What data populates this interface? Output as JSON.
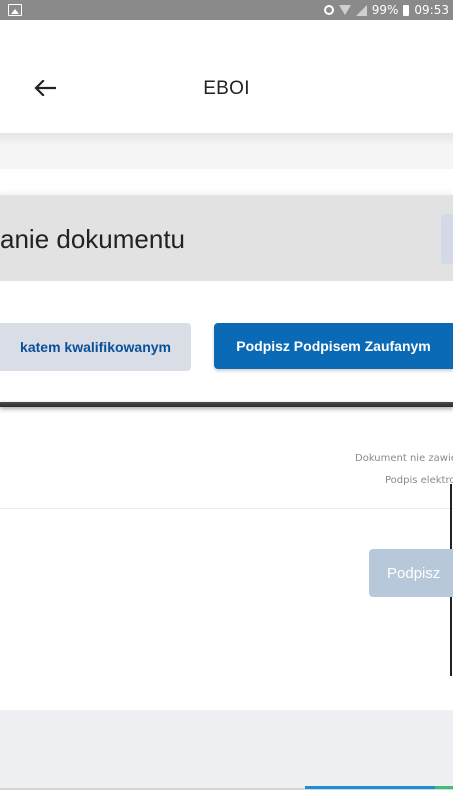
{
  "status_bar": {
    "battery": "99%",
    "time": "09:53",
    "icons": [
      "image-icon",
      "alarm-icon",
      "wifi-icon",
      "signal-icon",
      "battery-icon"
    ]
  },
  "header": {
    "back_icon": "back-arrow-icon",
    "title": "EBOI"
  },
  "main": {
    "heading": "anie dokumentu",
    "cert_button_label": "katem kwalifikowanym",
    "trusted_button_label": "Podpisz Podpisem Zaufanym",
    "info_line1": "Dokument nie zawie",
    "info_line2": "Podpis elektro",
    "sign_button_label": "Podpisz"
  },
  "colors": {
    "primary": "#0b6ab5",
    "secondary_button_bg": "#d9dde6",
    "disabled_button_bg": "#b7c8da",
    "heading_band": "#e2e2e2"
  }
}
